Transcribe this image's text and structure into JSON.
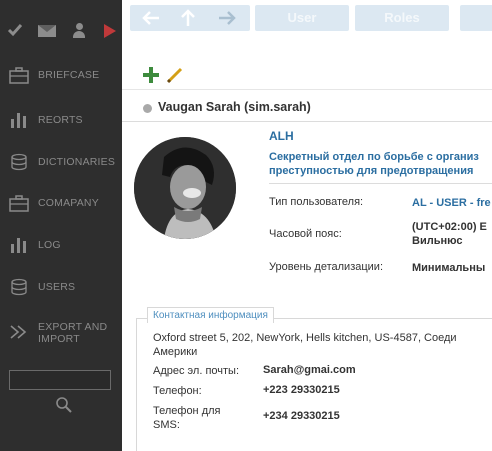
{
  "sidebar": {
    "top_icons": [
      "check-icon",
      "mail-icon",
      "person-icon",
      "play-icon"
    ],
    "items": [
      {
        "label": "BRIEFCASE",
        "icon": "briefcase-icon"
      },
      {
        "label": "REORTS",
        "icon": "bar-chart-icon"
      },
      {
        "label": "DICTIONARIES",
        "icon": "database-icon"
      },
      {
        "label": "COMAPANY",
        "icon": "briefcase-icon"
      },
      {
        "label": "LOG",
        "icon": "bar-chart-icon"
      },
      {
        "label": "USERS",
        "icon": "database-icon"
      },
      {
        "label": "EXPORT AND",
        "label2": "IMPORT",
        "icon": "export-icon"
      }
    ],
    "search_placeholder": ""
  },
  "topbar": {
    "tabs": [
      {
        "label": "User"
      },
      {
        "label": "Roles"
      }
    ]
  },
  "user": {
    "name": "Vaugan Sarah (sim.sarah)",
    "org_code": "ALH",
    "org_desc_line1": "Секретный отдел по борьбе с организ",
    "org_desc_line2": "преступностью для предотвращения"
  },
  "info": {
    "user_type_label": "Тип пользователя:",
    "user_type_value": "AL - USER - fre",
    "timezone_label": "Часовой пояс:",
    "timezone_value_line1": "(UTC+02:00) E",
    "timezone_value_line2": "Вильнюс",
    "detail_label": "Уровень детализации:",
    "detail_value": "Минимальны"
  },
  "contact": {
    "legend": "Контактная информация",
    "address_line1": "Oxford street 5, 202, NewYork, Hells kitchen, US-4587, Соеди",
    "address_line2": "Америки",
    "email_label": "Адрес эл. почты:",
    "email_value": "Sarah@gmai.com",
    "phone_label": "Телефон:",
    "phone_value": "+223 29330215",
    "sms_label_line1": "Телефон для",
    "sms_label_line2": "SMS:",
    "sms_value": "+234 29330215"
  },
  "colors": {
    "sidebar_bg": "#2e2e2e",
    "accent_blue": "#2b6ea1",
    "tab_bg": "#dce8f2",
    "add_green": "#3d8b3d",
    "play_red": "#c0393a"
  }
}
